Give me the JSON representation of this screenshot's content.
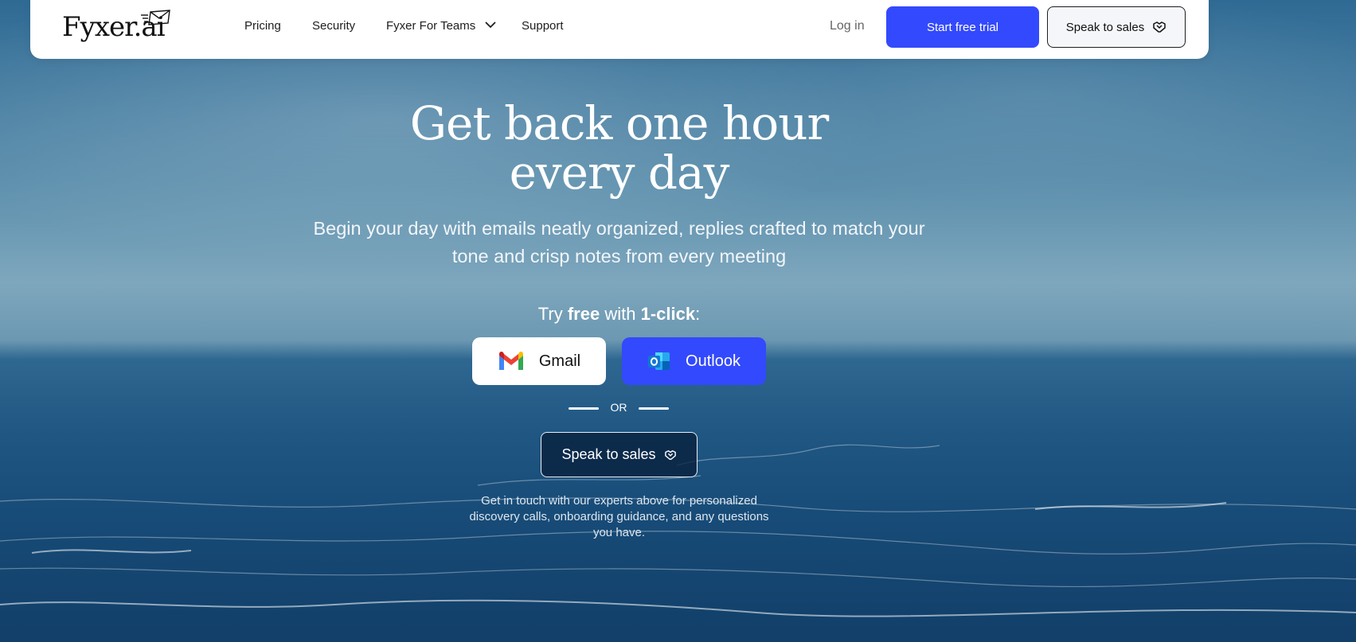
{
  "header": {
    "logo": "Fyxer.ai",
    "nav": [
      {
        "label": "Pricing"
      },
      {
        "label": "Security"
      },
      {
        "label": "Fyxer For Teams",
        "icon": "chevron-down-icon"
      },
      {
        "label": "Support"
      }
    ],
    "login_label": "Log in",
    "trial_label": "Start free trial",
    "sales_label": "Speak to sales"
  },
  "hero": {
    "title_line1": "Get back one hour",
    "title_line2": "every day",
    "subtitle_line1": "Begin your day with emails neatly organized, replies crafted to match your",
    "subtitle_line2": "tone and crisp notes from every meeting",
    "try_prefix": "Try ",
    "try_free": "free",
    "try_mid": " with ",
    "try_oneclick": "1-click",
    "try_suffix": ":",
    "gmail_label": "Gmail",
    "outlook_label": "Outlook",
    "or_label": "OR",
    "sales_label": "Speak to sales",
    "note_line1": "Get in touch with our experts above for personalized",
    "note_line2": "discovery calls, onboarding guidance, and any questions",
    "note_line3": "you have."
  },
  "colors": {
    "accent": "#3349fd",
    "header_bg": "#ffffff",
    "sea_dark": "#113f69"
  },
  "icons": [
    "mail-logo-icon",
    "chevron-down-icon",
    "handshake-icon",
    "gmail-icon",
    "outlook-icon"
  ]
}
